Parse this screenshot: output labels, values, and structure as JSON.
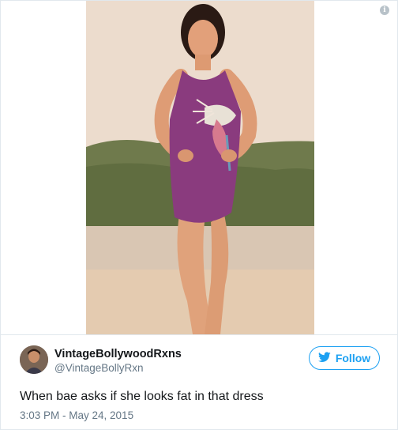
{
  "tweet": {
    "author": {
      "display_name": "VintageBollywoodRxns",
      "screen_name": "@VintageBollyRxn"
    },
    "follow_label": "Follow",
    "text": "When bae asks if she looks fat in that dress",
    "timestamp": "3:03 PM - May 24, 2015",
    "info_glyph": "i"
  },
  "icons": {
    "info": "info-icon",
    "follow": "twitter-bird-icon"
  },
  "colors": {
    "accent": "#1da1f2",
    "text_primary": "#14171a",
    "text_secondary": "#657786",
    "border": "#e1e8ed"
  }
}
